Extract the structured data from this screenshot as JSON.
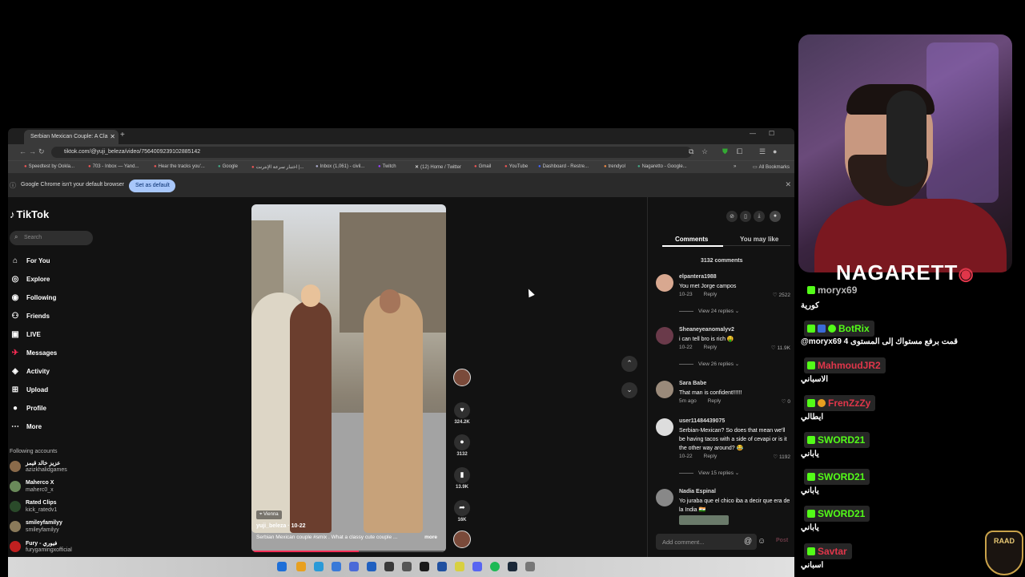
{
  "browser": {
    "tab_title": "Serbian Mexican Couple: A Cla",
    "url": "tiktok.com/@yuji_beleza/video/7564009239102885142",
    "bookmarks": [
      "Speedtest by Ookla...",
      "703 - Inbox — Yand...",
      "Hear the tracks you'...",
      "Google",
      "اختبار سرعة الإنترنت |...",
      "Inbox (1,061) - civil...",
      "Twitch",
      "(12) Home / Twitter",
      "Gmail",
      "YouTube",
      "Dashboard - Restre...",
      "trendyol",
      "Nagaretto - Google..."
    ],
    "all_bookmarks": "All Bookmarks",
    "infobar_message": "Google Chrome isn't your default browser",
    "set_default_label": "Set as default"
  },
  "tiktok": {
    "logo": "TikTok",
    "search_placeholder": "Search",
    "nav": [
      {
        "label": "For You",
        "icon": "home-icon"
      },
      {
        "label": "Explore",
        "icon": "compass-icon"
      },
      {
        "label": "Following",
        "icon": "following-icon"
      },
      {
        "label": "Friends",
        "icon": "friends-icon"
      },
      {
        "label": "LIVE",
        "icon": "live-icon"
      },
      {
        "label": "Messages",
        "icon": "messages-icon"
      },
      {
        "label": "Activity",
        "icon": "activity-icon"
      },
      {
        "label": "Upload",
        "icon": "upload-icon"
      },
      {
        "label": "Profile",
        "icon": "profile-icon"
      },
      {
        "label": "More",
        "icon": "more-icon"
      }
    ],
    "following_header": "Following accounts",
    "following_accounts": [
      {
        "name": "عزيز خالد قيمز",
        "handle": "azizkhalidgames"
      },
      {
        "name": "Maherco X",
        "handle": "maherc0_x"
      },
      {
        "name": "Rated Clips",
        "handle": "kick_ratedv1"
      },
      {
        "name": "smileyfamilyy",
        "handle": "smileyfamilyy"
      },
      {
        "name": "Fury - فيوري",
        "handle": "furygamingxofficial"
      }
    ],
    "video": {
      "location": "Vienna",
      "author": "yuji_beleza · 10-22",
      "description": "Serbian Mexican couple #smix . What a classy cute couple ...",
      "more_label": "more",
      "progress": 0.55
    },
    "actions": {
      "likes": "324.2K",
      "comments": "3132",
      "saves": "13.9K",
      "shares": "16K"
    },
    "comments_panel": {
      "tab_comments": "Comments",
      "tab_you_may_like": "You may like",
      "count_label": "3132 comments",
      "comments": [
        {
          "user": "elpantera1988",
          "text": "You met Jorge campos",
          "date": "10-23",
          "reply": "Reply",
          "likes": "2522",
          "views": "View 24 replies"
        },
        {
          "user": "Sheaneyeanomalyv2",
          "text": "i can tell bro is rich 🤑",
          "date": "10-22",
          "reply": "Reply",
          "likes": "11.9K",
          "views": "View 26 replies"
        },
        {
          "user": "Sara Babe",
          "text": "That man is confident!!!!!!",
          "date": "5m ago",
          "reply": "Reply",
          "likes": "0",
          "views": ""
        },
        {
          "user": "user11484439075",
          "text": "Serbian-Mexican? So does that mean we'll be having tacos with a side of cevapi or is it the other way around? 😂",
          "date": "10-22",
          "reply": "Reply",
          "likes": "1192",
          "views": "View 15 replies"
        },
        {
          "user": "Nadia Espinal",
          "text": "Yo juraba que el chico iba a decir que era de la India 🇮🇳",
          "date": "",
          "reply": "",
          "likes": "",
          "views": ""
        }
      ],
      "add_comment_placeholder": "Add comment...",
      "post_label": "Post"
    }
  },
  "stream": {
    "streamer_name": "NAGARETT",
    "chat": [
      {
        "user": "moryx69",
        "color": "#b8b8b8",
        "message": "كورية"
      },
      {
        "user": "BotRix",
        "color": "#53fc18",
        "message": "@moryx69 قمت برفع مستواك إلى المستوى 4"
      },
      {
        "user": "MahmoudJR2",
        "color": "#e0364a",
        "message": "الاسباني"
      },
      {
        "user": "FrenZzZy",
        "color": "#e0364a",
        "message": "ايطالي"
      },
      {
        "user": "SWORD21",
        "color": "#53fc18",
        "message": "ياباني"
      },
      {
        "user": "SWORD21",
        "color": "#53fc18",
        "message": "ياباني"
      },
      {
        "user": "SWORD21",
        "color": "#53fc18",
        "message": "ياباني"
      },
      {
        "user": "Savtar",
        "color": "#e0364a",
        "message": "اسباني"
      }
    ],
    "logo_text": "RAAD"
  },
  "colors": {
    "tiktok_red": "#fe2c55",
    "kick_green": "#53fc18",
    "chrome_blue": "#a8c7fa"
  }
}
